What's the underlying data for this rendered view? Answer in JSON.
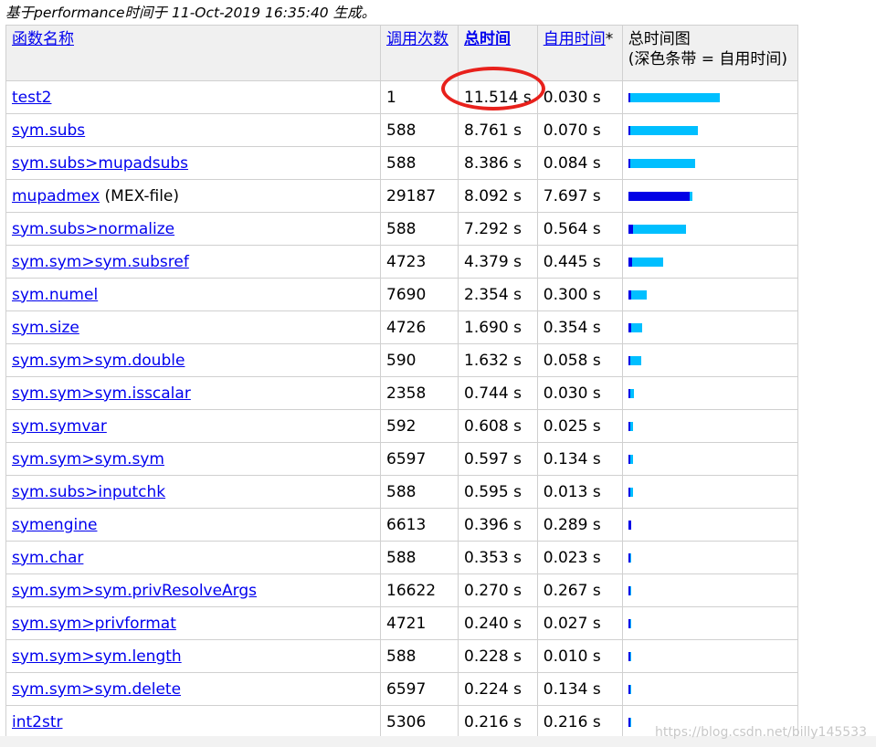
{
  "caption": "基于performance时间于 11-Oct-2019 16:35:40 生成。",
  "header": {
    "name": "函数名称",
    "calls": "调用次数",
    "total_time": "总时间",
    "self_time": "自用时间",
    "self_time_mark": "*",
    "plot_line1": "总时间图",
    "plot_line2": "(深色条带 = 自用时间)"
  },
  "rows": [
    {
      "name": "test2",
      "suffix": "",
      "calls": "1",
      "total": "11.514 s",
      "self": "0.030 s",
      "total_frac": 1.0,
      "self_frac": 0.0026
    },
    {
      "name": "sym.subs",
      "suffix": "",
      "calls": "588",
      "total": "8.761 s",
      "self": "0.070 s",
      "total_frac": 0.761,
      "self_frac": 0.0061
    },
    {
      "name": "sym.subs>mupadsubs",
      "suffix": "",
      "calls": "588",
      "total": "8.386 s",
      "self": "0.084 s",
      "total_frac": 0.728,
      "self_frac": 0.0073
    },
    {
      "name": "mupadmex",
      "suffix": " (MEX-file)",
      "calls": "29187",
      "total": "8.092 s",
      "self": "7.697 s",
      "total_frac": 0.703,
      "self_frac": 0.668
    },
    {
      "name": "sym.subs>normalize",
      "suffix": "",
      "calls": "588",
      "total": "7.292 s",
      "self": "0.564 s",
      "total_frac": 0.633,
      "self_frac": 0.049
    },
    {
      "name": "sym.sym>sym.subsref",
      "suffix": "",
      "calls": "4723",
      "total": "4.379 s",
      "self": "0.445 s",
      "total_frac": 0.38,
      "self_frac": 0.0386
    },
    {
      "name": "sym.numel",
      "suffix": "",
      "calls": "7690",
      "total": "2.354 s",
      "self": "0.300 s",
      "total_frac": 0.204,
      "self_frac": 0.026
    },
    {
      "name": "sym.size",
      "suffix": "",
      "calls": "4726",
      "total": "1.690 s",
      "self": "0.354 s",
      "total_frac": 0.147,
      "self_frac": 0.0307
    },
    {
      "name": "sym.sym>sym.double",
      "suffix": "",
      "calls": "590",
      "total": "1.632 s",
      "self": "0.058 s",
      "total_frac": 0.142,
      "self_frac": 0.005
    },
    {
      "name": "sym.sym>sym.isscalar",
      "suffix": "",
      "calls": "2358",
      "total": "0.744 s",
      "self": "0.030 s",
      "total_frac": 0.0646,
      "self_frac": 0.0026
    },
    {
      "name": "sym.symvar",
      "suffix": "",
      "calls": "592",
      "total": "0.608 s",
      "self": "0.025 s",
      "total_frac": 0.0528,
      "self_frac": 0.0022
    },
    {
      "name": "sym.sym>sym.sym",
      "suffix": "",
      "calls": "6597",
      "total": "0.597 s",
      "self": "0.134 s",
      "total_frac": 0.0518,
      "self_frac": 0.0116
    },
    {
      "name": "sym.subs>inputchk",
      "suffix": "",
      "calls": "588",
      "total": "0.595 s",
      "self": "0.013 s",
      "total_frac": 0.0517,
      "self_frac": 0.0011
    },
    {
      "name": "symengine",
      "suffix": "",
      "calls": "6613",
      "total": "0.396 s",
      "self": "0.289 s",
      "total_frac": 0.0344,
      "self_frac": 0.0251
    },
    {
      "name": "sym.char",
      "suffix": "",
      "calls": "588",
      "total": "0.353 s",
      "self": "0.023 s",
      "total_frac": 0.0307,
      "self_frac": 0.002
    },
    {
      "name": "sym.sym>sym.privResolveArgs",
      "suffix": "",
      "calls": "16622",
      "total": "0.270 s",
      "self": "0.267 s",
      "total_frac": 0.0234,
      "self_frac": 0.0232
    },
    {
      "name": "sym.sym>privformat",
      "suffix": "",
      "calls": "4721",
      "total": "0.240 s",
      "self": "0.027 s",
      "total_frac": 0.0208,
      "self_frac": 0.0023
    },
    {
      "name": "sym.sym>sym.length",
      "suffix": "",
      "calls": "588",
      "total": "0.228 s",
      "self": "0.010 s",
      "total_frac": 0.0198,
      "self_frac": 0.0009
    },
    {
      "name": "sym.sym>sym.delete",
      "suffix": "",
      "calls": "6597",
      "total": "0.224 s",
      "self": "0.134 s",
      "total_frac": 0.0195,
      "self_frac": 0.0116
    },
    {
      "name": "int2str",
      "suffix": "",
      "calls": "5306",
      "total": "0.216 s",
      "self": "0.216 s",
      "total_frac": 0.0188,
      "self_frac": 0.0188
    }
  ],
  "colors": {
    "total_bar": "#00bfff",
    "self_bar": "#0000e6",
    "highlight": "#e8211c",
    "link": "#0000ee"
  },
  "watermark": "https://blog.csdn.net/billy145533"
}
